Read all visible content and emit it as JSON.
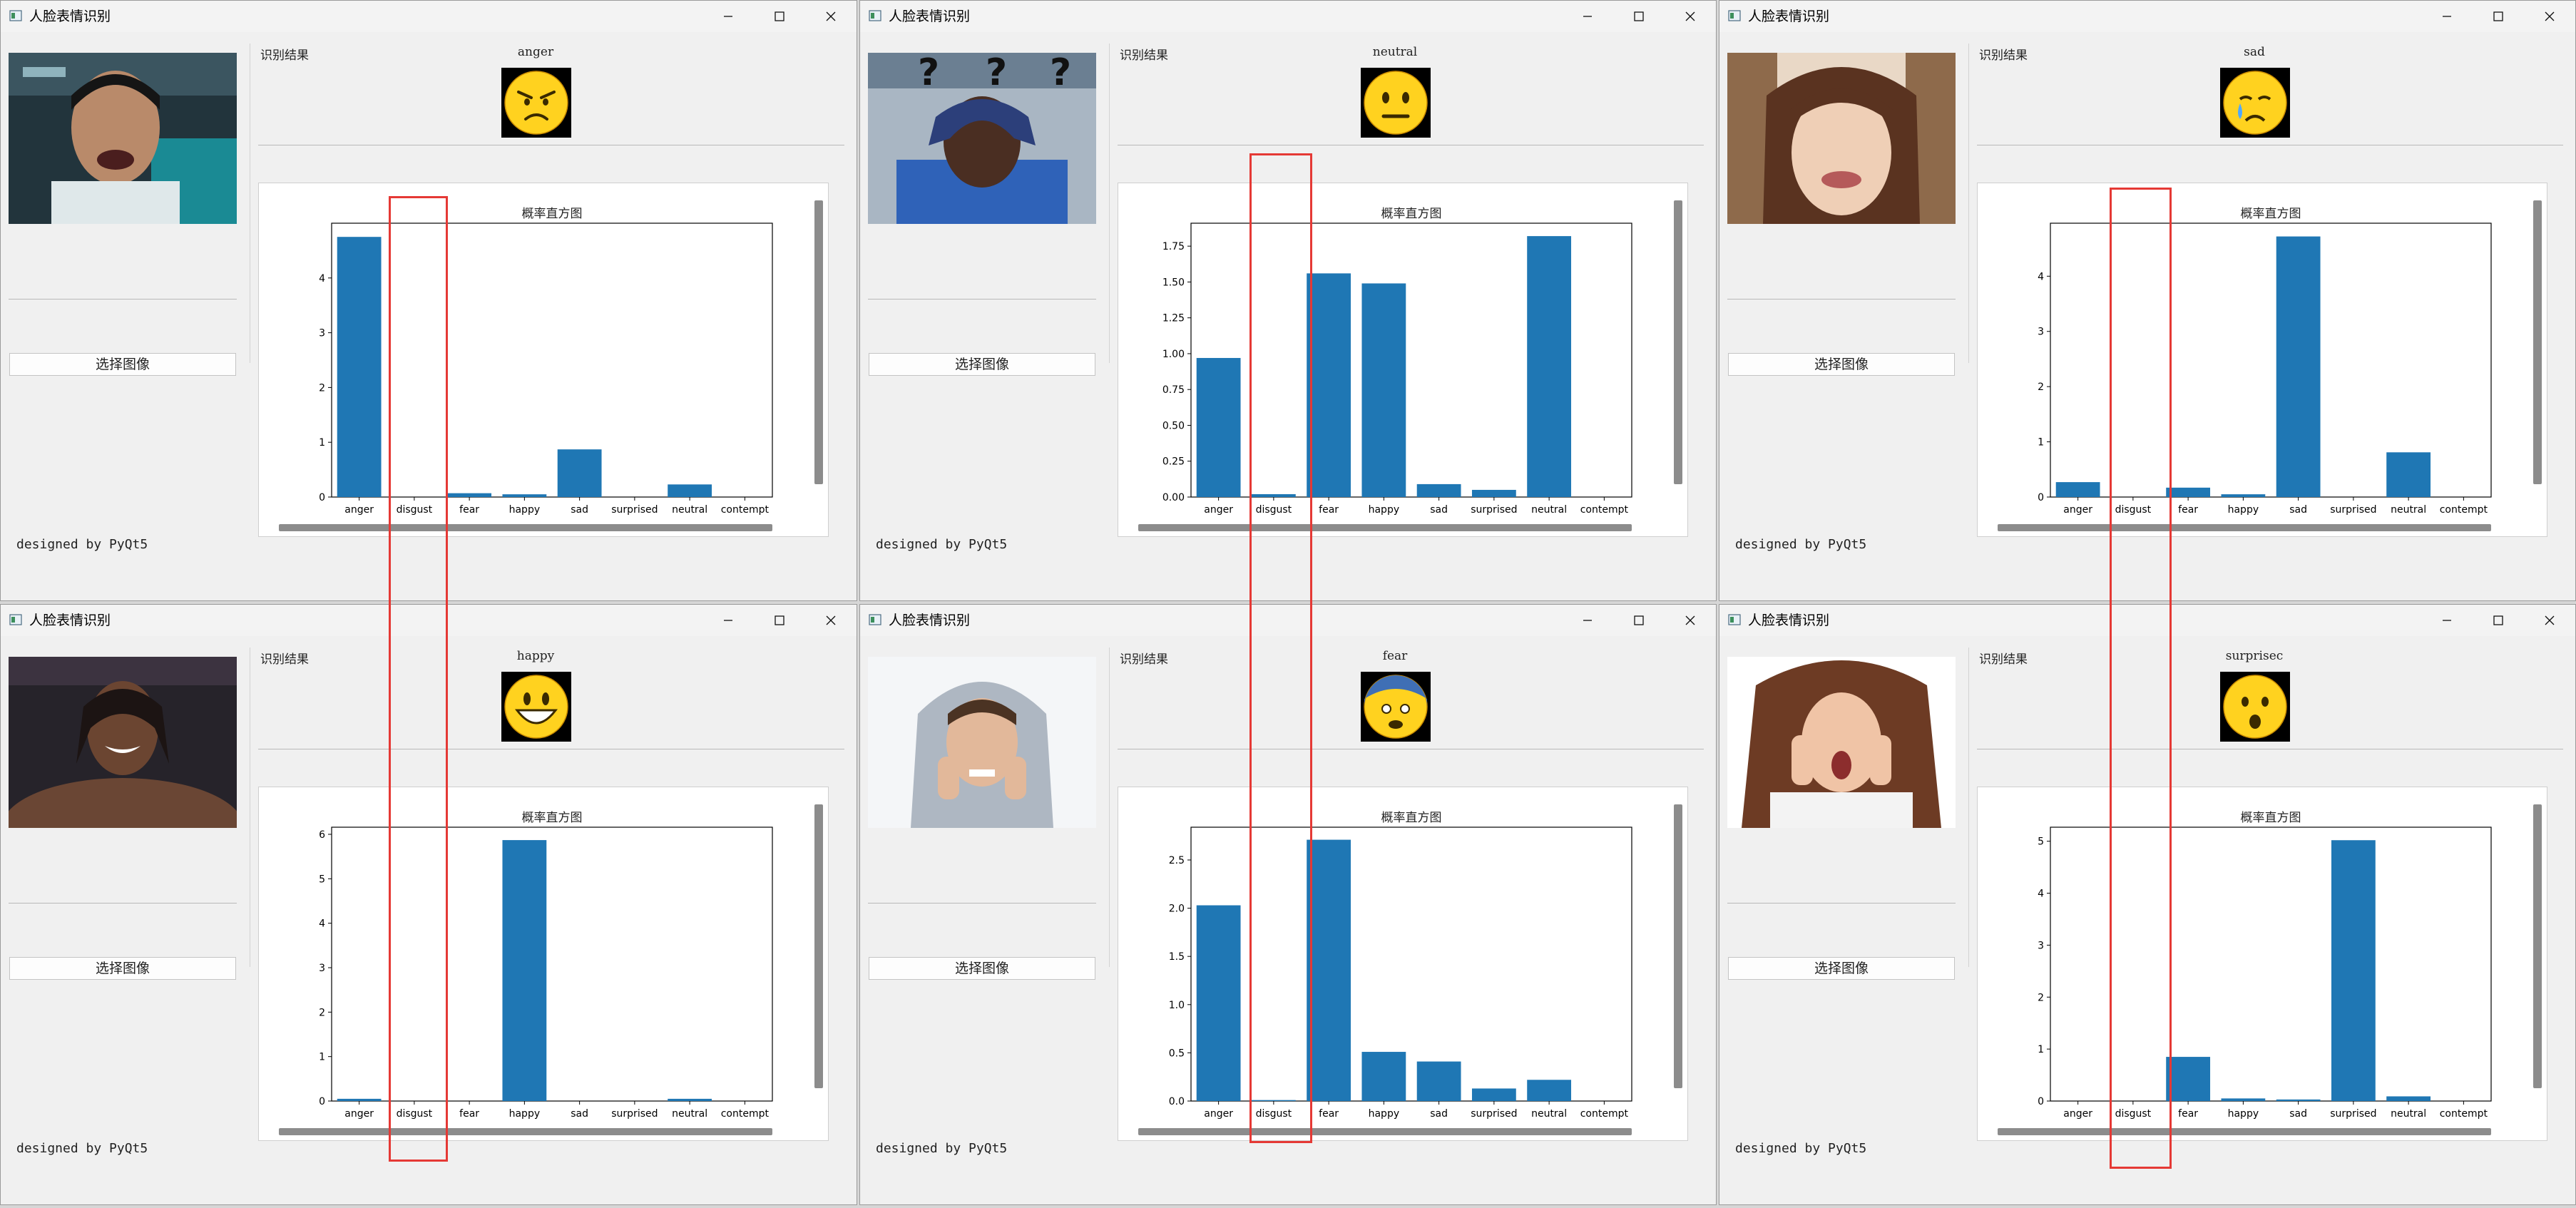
{
  "windows": [
    {
      "title": "人脸表情识别",
      "photo": "young man shouting in dim room",
      "select_button": "选择图像",
      "result_label": "识别结果",
      "emotion": "anger",
      "emoji_icon": "angry-face-icon",
      "footer": "designed by PyQt5",
      "chart_data": {
        "type": "bar",
        "title": "概率直方图",
        "categories": [
          "anger",
          "disgust",
          "fear",
          "happy",
          "sad",
          "surprised",
          "neutral",
          "contempt"
        ],
        "values": [
          4.75,
          0.0,
          0.07,
          0.05,
          0.87,
          0.0,
          0.23,
          0.0
        ],
        "yticks": [
          "0",
          "1",
          "2",
          "3",
          "4"
        ],
        "ylim": [
          0,
          5.0
        ],
        "grid": false,
        "color": "#1f77b4"
      }
    },
    {
      "title": "人脸表情识别",
      "photo": "man holding his head with question marks above",
      "select_button": "选择图像",
      "result_label": "识别结果",
      "emotion": "neutral",
      "emoji_icon": "neutral-face-icon",
      "footer": "designed by PyQt5",
      "chart_data": {
        "type": "bar",
        "title": "概率直方图",
        "categories": [
          "anger",
          "disgust",
          "fear",
          "happy",
          "sad",
          "surprised",
          "neutral",
          "contempt"
        ],
        "values": [
          0.97,
          0.02,
          1.56,
          1.49,
          0.09,
          0.05,
          1.82,
          0.0
        ],
        "yticks": [
          "0.00",
          "0.25",
          "0.50",
          "0.75",
          "1.00",
          "1.25",
          "1.50",
          "1.75"
        ],
        "ylim": [
          0,
          1.91
        ],
        "grid": false,
        "color": "#1f77b4"
      }
    },
    {
      "title": "人脸表情识别",
      "photo": "woman with bangs crying",
      "select_button": "选择图像",
      "result_label": "识别结果",
      "emotion": "sad",
      "emoji_icon": "crying-face-icon",
      "footer": "designed by PyQt5",
      "chart_data": {
        "type": "bar",
        "title": "概率直方图",
        "categories": [
          "anger",
          "disgust",
          "fear",
          "happy",
          "sad",
          "surprised",
          "neutral",
          "contempt"
        ],
        "values": [
          0.27,
          0.0,
          0.17,
          0.05,
          4.72,
          0.0,
          0.81,
          0.0
        ],
        "yticks": [
          "0",
          "1",
          "2",
          "3",
          "4"
        ],
        "ylim": [
          0,
          4.96
        ],
        "grid": false,
        "color": "#1f77b4"
      }
    },
    {
      "title": "人脸表情识别",
      "photo": "smiling shirtless man at an event",
      "select_button": "选择图像",
      "result_label": "识别结果",
      "emotion": "happy",
      "emoji_icon": "grinning-face-icon",
      "footer": "designed by PyQt5",
      "chart_data": {
        "type": "bar",
        "title": "概率直方图",
        "categories": [
          "anger",
          "disgust",
          "fear",
          "happy",
          "sad",
          "surprised",
          "neutral",
          "contempt"
        ],
        "values": [
          0.05,
          0.0,
          0.0,
          5.87,
          0.0,
          0.0,
          0.05,
          0.0
        ],
        "yticks": [
          "0",
          "1",
          "2",
          "3",
          "4",
          "5",
          "6"
        ],
        "ylim": [
          0,
          6.16
        ],
        "grid": false,
        "color": "#1f77b4"
      }
    },
    {
      "title": "人脸表情识别",
      "photo": "frightened woman in grey hoodie",
      "select_button": "选择图像",
      "result_label": "识别结果",
      "emotion": "fear",
      "emoji_icon": "fearful-face-icon",
      "footer": "designed by PyQt5",
      "chart_data": {
        "type": "bar",
        "title": "概率直方图",
        "categories": [
          "anger",
          "disgust",
          "fear",
          "happy",
          "sad",
          "surprised",
          "neutral",
          "contempt"
        ],
        "values": [
          2.03,
          0.01,
          2.71,
          0.51,
          0.41,
          0.13,
          0.22,
          0.0
        ],
        "yticks": [
          "0.0",
          "0.5",
          "1.0",
          "1.5",
          "2.0",
          "2.5"
        ],
        "ylim": [
          0,
          2.84
        ],
        "grid": false,
        "color": "#1f77b4"
      }
    },
    {
      "title": "人脸表情识别",
      "photo": "surprised woman with hands on face",
      "select_button": "选择图像",
      "result_label": "识别结果",
      "emotion": "surprisec",
      "emoji_icon": "hushed-face-icon",
      "footer": "designed by PyQt5",
      "chart_data": {
        "type": "bar",
        "title": "概率直方图",
        "categories": [
          "anger",
          "disgust",
          "fear",
          "happy",
          "sad",
          "surprised",
          "neutral",
          "contempt"
        ],
        "values": [
          0.0,
          0.0,
          0.85,
          0.05,
          0.03,
          5.02,
          0.09,
          0.0
        ],
        "yticks": [
          "0",
          "1",
          "2",
          "3",
          "4",
          "5"
        ],
        "ylim": [
          0,
          5.27
        ],
        "grid": false,
        "color": "#1f77b4"
      }
    }
  ],
  "highlight_color": "#e53935"
}
